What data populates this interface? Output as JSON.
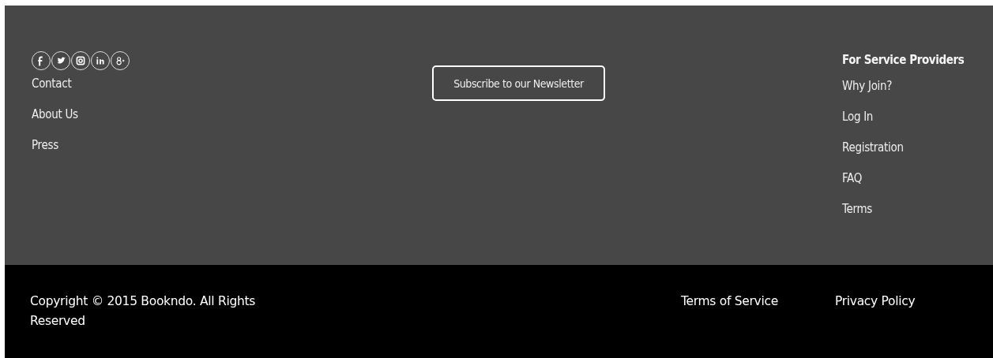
{
  "footer": {
    "social_links": [
      {
        "kind": "facebook"
      },
      {
        "kind": "twitter"
      },
      {
        "kind": "instagram"
      },
      {
        "kind": "linkedin"
      },
      {
        "kind": "googleplus"
      }
    ],
    "links": [
      "Contact",
      "About Us",
      "Press"
    ],
    "newsletter_button": "Subscribe to our Newsletter",
    "providers": {
      "heading": "For Service Providers",
      "links": [
        "Why Join?",
        "Log In",
        "Registration",
        "FAQ",
        "Terms"
      ]
    }
  },
  "bottom_bar": {
    "copyright": "Copyright © 2015 Bookndo. All Rights Reserved",
    "links": [
      "Terms of Service",
      "Privacy Policy"
    ]
  }
}
